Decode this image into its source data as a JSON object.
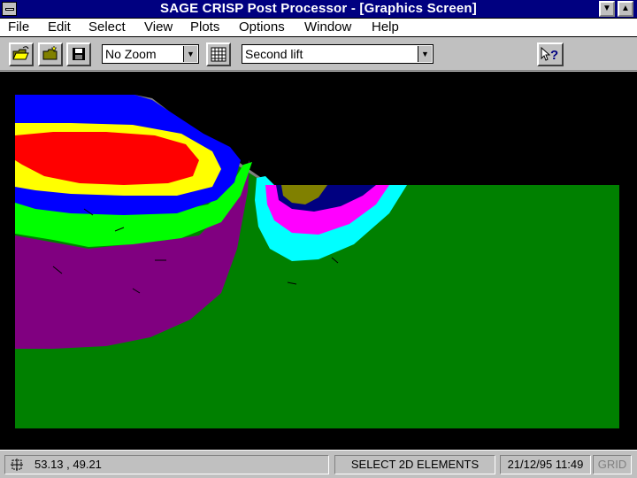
{
  "window": {
    "title": "SAGE CRISP Post Processor - [Graphics Screen]",
    "minimize_glyph": "▼",
    "maximize_glyph": "▲"
  },
  "menu": {
    "items": [
      {
        "label": "File"
      },
      {
        "label": "Edit"
      },
      {
        "label": "Select"
      },
      {
        "label": "View"
      },
      {
        "label": "Plots"
      },
      {
        "label": "Options"
      },
      {
        "label": "Window"
      },
      {
        "label": "Help"
      }
    ]
  },
  "toolbar": {
    "buttons": [
      {
        "icon": "open-folder-icon"
      },
      {
        "icon": "folder-icon"
      },
      {
        "icon": "save-disk-icon"
      },
      {
        "icon": "grid-icon"
      },
      {
        "icon": "context-help-icon"
      }
    ],
    "zoom_select": {
      "value": "No Zoom"
    },
    "stage_select": {
      "value": "Second lift"
    },
    "dropdown_glyph": "▼",
    "help_glyph": "?"
  },
  "plot": {
    "type": "contour",
    "colors": {
      "background": "#000000",
      "blue": "#0000ff",
      "yellow": "#ffff00",
      "red": "#ff0000",
      "green_bright": "#00ff00",
      "purple": "#800080",
      "green_dark": "#008000",
      "cyan": "#00ffff",
      "magenta": "#ff00ff",
      "navy": "#000080",
      "olive": "#808000",
      "slope_face": "#808080"
    }
  },
  "status": {
    "coordinates": "53.13 , 49.21",
    "mode": "SELECT 2D ELEMENTS",
    "datetime": "21/12/95 11:49",
    "grid": "GRID",
    "grid_color": "#808080"
  }
}
